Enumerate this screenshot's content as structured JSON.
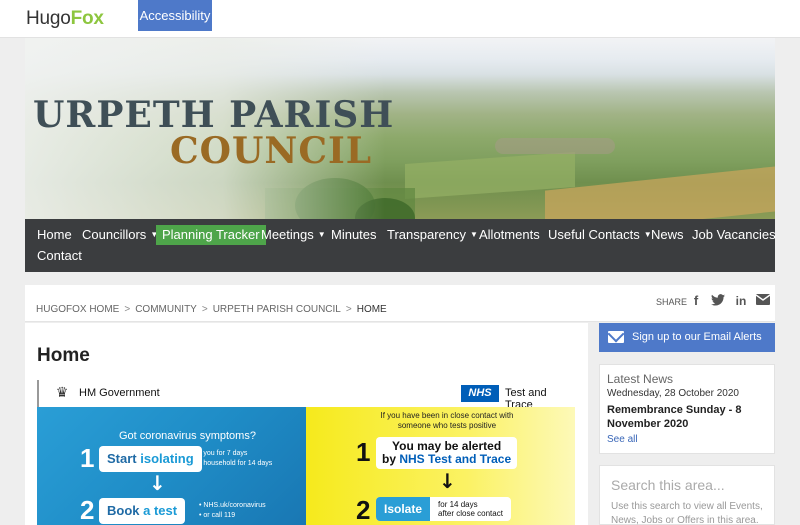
{
  "header": {
    "logo_part1": "Hugo",
    "logo_part2": "Fox",
    "accessibility_label": "Accessibility"
  },
  "banner": {
    "title_line1": "URPETH PARISH",
    "title_line2": "COUNCIL"
  },
  "nav": {
    "items": [
      {
        "label": "Home"
      },
      {
        "label": "Councillors",
        "dropdown": true
      },
      {
        "label": "Planning Tracker",
        "active": true
      },
      {
        "label": "Meetings",
        "dropdown": true
      },
      {
        "label": "Minutes"
      },
      {
        "label": "Transparency",
        "dropdown": true
      },
      {
        "label": "Allotments"
      },
      {
        "label": "Useful Contacts",
        "dropdown": true
      },
      {
        "label": "News"
      },
      {
        "label": "Job Vacancies"
      },
      {
        "label": "Contact"
      }
    ],
    "caret": "▼"
  },
  "breadcrumb": {
    "items": [
      "HUGOFOX HOME",
      "COMMUNITY",
      "URPETH PARISH COUNCIL",
      "HOME"
    ],
    "separator": ">",
    "share_label": "SHARE",
    "share_icons": [
      "facebook-icon",
      "twitter-icon",
      "linkedin-icon",
      "email-icon"
    ]
  },
  "main": {
    "page_title": "Home",
    "poster": {
      "hm_gov": "HM Government",
      "nhs": "NHS",
      "test_trace": "Test and Trace",
      "left_question": "Got coronavirus symptoms?",
      "step1_num": "1",
      "step1_label_a": "Start ",
      "step1_label_b": "isolating",
      "step1_detail1": "• you for 7 days",
      "step1_detail2": "• household for 14 days",
      "step2_num": "2",
      "step2_label_a": "Book ",
      "step2_label_b": "a test",
      "step2_detail1": "• NHS.uk/coronavirus",
      "step2_detail2": "• or call 119",
      "right_question": "If you have been in close contact with someone who tests positive",
      "r1_num": "1",
      "r1_line1": "You may be alerted",
      "r1_line2a": "by ",
      "r1_line2b": "NHS Test and Trace",
      "r2_num": "2",
      "r2_label": "Isolate",
      "r2_detail1": "for 14 days",
      "r2_detail2": "after close contact",
      "arrow": "↓"
    }
  },
  "sidebar": {
    "alerts_label": "Sign up to our Email Alerts",
    "news": {
      "heading": "Latest News",
      "date": "Wednesday, 28 October 2020",
      "title": "Remembrance Sunday - 8 November 2020",
      "link": "See all"
    },
    "search": {
      "placeholder": "Search this area...",
      "description": "Use this search to view all Events, News, Jobs or Offers in this area."
    }
  },
  "colors": {
    "brand_green": "#8dc63f",
    "accent_blue": "#4e79c9",
    "nav_bg": "#3b3d3f",
    "nav_active": "#4ea54a",
    "nhs_blue": "#005eb8"
  }
}
